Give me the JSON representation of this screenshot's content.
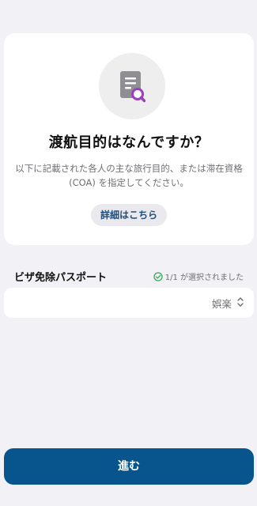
{
  "card": {
    "title": "渡航目的はなんですか？",
    "description": "以下に記載された各人の主な旅行目的、または滞在資格 (COA) を指定してください。",
    "details_button": "詳細はこちら",
    "icon": "document-search-icon"
  },
  "section": {
    "label": "ビザ免除パスポート",
    "status": "1/1 が選択されました",
    "status_icon": "check-circle-icon"
  },
  "select": {
    "value": "娯楽",
    "icon": "chevron-updown-icon"
  },
  "footer": {
    "proceed_label": "進む"
  },
  "colors": {
    "background": "#f2f1f6",
    "primary_button": "#07558c",
    "link": "#1d4f7e",
    "check_green": "#34a853",
    "icon_purple": "#9b3fc0"
  }
}
